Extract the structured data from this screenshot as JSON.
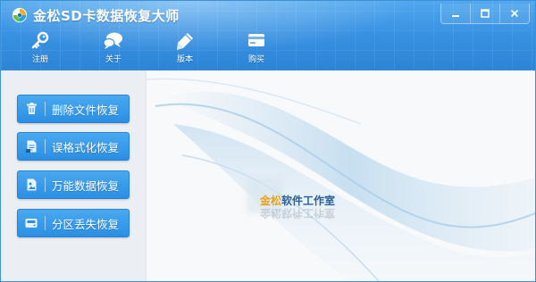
{
  "app": {
    "title": "金松SD卡数据恢复大师"
  },
  "window_controls": {
    "minimize": "—",
    "maximize": "☐",
    "close": "✕"
  },
  "toolbar": [
    {
      "label": "注册",
      "icon": "key-icon"
    },
    {
      "label": "关于",
      "icon": "chat-bubbles-icon"
    },
    {
      "label": "版本",
      "icon": "pen-icon"
    },
    {
      "label": "购买",
      "icon": "card-icon"
    }
  ],
  "sidebar": {
    "buttons": [
      {
        "label": "删除文件恢复",
        "icon": "trash-icon"
      },
      {
        "label": "误格式化恢复",
        "icon": "document-icon"
      },
      {
        "label": "万能数据恢复",
        "icon": "image-file-icon"
      },
      {
        "label": "分区丢失恢复",
        "icon": "disk-icon"
      }
    ]
  },
  "content": {
    "brand_part1": "金松",
    "brand_part2": "软件工作室"
  },
  "colors": {
    "header": "#3a92e2",
    "button": "#2a8fe4",
    "brand_gold": "#e8a319",
    "brand_blue": "#2b5f96"
  }
}
